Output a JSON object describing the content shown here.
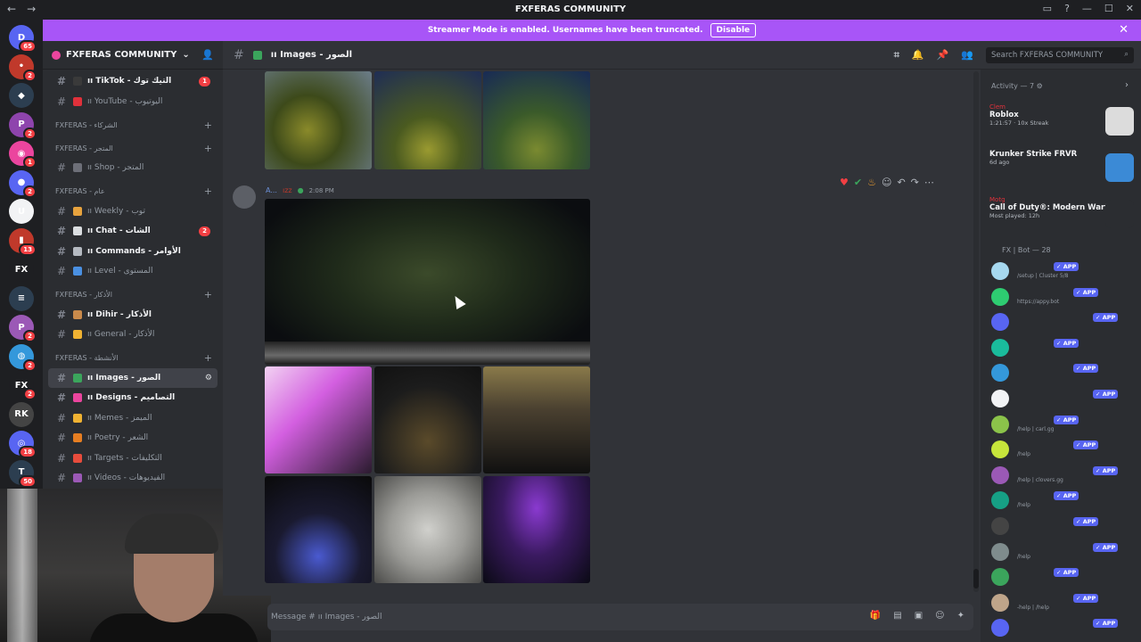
{
  "window": {
    "title": "FXFERAS COMMUNITY"
  },
  "banner": {
    "text": "Streamer Mode is enabled. Usernames have been truncated.",
    "disable_label": "Disable"
  },
  "server": {
    "name": "FXFERAS COMMUNITY"
  },
  "sidebar": {
    "items": [
      {
        "kind": "channel",
        "label": "ıı TikTok - التيك توك",
        "badge": "1",
        "bright": true,
        "emoji_color": "#3a3a3a"
      },
      {
        "kind": "channel",
        "label": "ıı YouTube - اليوتيوب",
        "badge": "",
        "bright": false,
        "emoji_color": "#e0313b"
      },
      {
        "kind": "category",
        "label": "FXFERAS - الشركاء"
      },
      {
        "kind": "category",
        "label": "FXFERAS - المتجر"
      },
      {
        "kind": "channel",
        "label": "ıı Shop - المتجر",
        "badge": "",
        "bright": false,
        "emoji_color": "#6d6f78"
      },
      {
        "kind": "category",
        "label": "FXFERAS - عام"
      },
      {
        "kind": "channel",
        "label": "ıı Weekly - توب",
        "badge": "",
        "bright": false,
        "emoji_color": "#e7a33e"
      },
      {
        "kind": "channel",
        "label": "ıı Chat - الشات",
        "badge": "2",
        "bright": true,
        "emoji_color": "#dbdee1"
      },
      {
        "kind": "channel",
        "label": "ıı Commands - الأوامر",
        "badge": "",
        "bright": true,
        "emoji_color": "#b5bac1"
      },
      {
        "kind": "channel",
        "label": "ıı Level - المستوى",
        "badge": "",
        "bright": false,
        "emoji_color": "#4a90e2"
      },
      {
        "kind": "category",
        "label": "FXFERAS - الأذكار"
      },
      {
        "kind": "channel",
        "label": "ıı Dihir - الأذكار",
        "badge": "",
        "bright": true,
        "emoji_color": "#c98a4b"
      },
      {
        "kind": "channel",
        "label": "ıı General - الأذكار",
        "badge": "",
        "bright": false,
        "emoji_color": "#f0b232"
      },
      {
        "kind": "category",
        "label": "FXFERAS - الأنشطة"
      },
      {
        "kind": "channel",
        "label": "ıı Images - الصور",
        "badge": "",
        "bright": true,
        "active": true,
        "emoji_color": "#3ba55c"
      },
      {
        "kind": "channel",
        "label": "ıı Designs - التصاميم",
        "badge": "",
        "bright": true,
        "emoji_color": "#eb459e"
      },
      {
        "kind": "channel",
        "label": "ıı Memes - الميمز",
        "badge": "",
        "bright": false,
        "emoji_color": "#f0b232"
      },
      {
        "kind": "channel",
        "label": "ıı Poetry - الشعر",
        "badge": "",
        "bright": false,
        "emoji_color": "#e67e22"
      },
      {
        "kind": "channel",
        "label": "ıı Targets - التكليفات",
        "badge": "",
        "bright": false,
        "emoji_color": "#e74c3c"
      },
      {
        "kind": "channel",
        "label": "ıı Videos - الفيديوهات",
        "badge": "",
        "bright": false,
        "emoji_color": "#9b59b6"
      }
    ]
  },
  "servers": [
    {
      "label": "D",
      "color": "#5865f2",
      "badge": "65"
    },
    {
      "label": "•",
      "color": "#c0392b",
      "badge": "2"
    },
    {
      "label": "◆",
      "color": "#2c3e50",
      "badge": ""
    },
    {
      "label": "P",
      "color": "#8e44ad",
      "badge": "2"
    },
    {
      "label": "◉",
      "color": "#eb459e",
      "badge": "1"
    },
    {
      "label": "●",
      "color": "#5865f2",
      "badge": "2"
    },
    {
      "label": "U",
      "color": "#f2f3f5",
      "badge": ""
    },
    {
      "label": "▮",
      "color": "#c0392b",
      "badge": "13"
    },
    {
      "label": "FX",
      "color": "#1e1f22",
      "badge": ""
    },
    {
      "label": "≡",
      "color": "#2c3e50",
      "badge": ""
    },
    {
      "label": "P",
      "color": "#9b59b6",
      "badge": "2"
    },
    {
      "label": "◍",
      "color": "#3498db",
      "badge": "2"
    },
    {
      "label": "FX",
      "color": "#1e1f22",
      "badge": "2"
    },
    {
      "label": "RK",
      "color": "#444",
      "badge": ""
    },
    {
      "label": "◎",
      "color": "#5865f2",
      "badge": "18"
    },
    {
      "label": "T",
      "color": "#2c3e50",
      "badge": "50"
    }
  ],
  "channel": {
    "title": "ıı Images - الصور"
  },
  "search": {
    "placeholder": "Search FXFERAS COMMUNITY"
  },
  "message": {
    "author": "A...",
    "tag": "ızz",
    "time": "2:08 PM"
  },
  "composer": {
    "placeholder": "Message # ıı Images - الصور"
  },
  "activity": {
    "header": "Activity — 7",
    "items": [
      {
        "user": "Clem",
        "game": "Roblox",
        "detail": "1:21:57 · 10x Streak",
        "thumb_color": "#dcdcdc"
      },
      {
        "user": "",
        "game": "Krunker Strike FRVR",
        "detail": "6d ago",
        "thumb_color": "#3b8ad6"
      },
      {
        "user": "Motg",
        "game": "Call of Duty®: Modern Warf...",
        "detail": "Most played: 12h",
        "thumb_color": "#2b2d31"
      }
    ]
  },
  "members": {
    "header": "FX | Bot — 28",
    "items": [
      {
        "status": "/setup | Cluster 5/8",
        "color": "#a6d8ef",
        "app": "✓ APP"
      },
      {
        "status": "https://appy.bot",
        "color": "#2ecc71",
        "app": "✓ APP"
      },
      {
        "status": "",
        "color": "#5865f2",
        "app": "✓ APP"
      },
      {
        "status": "",
        "color": "#1abc9c",
        "app": "✓ APP"
      },
      {
        "status": "",
        "color": "#3498db",
        "app": "✓ APP"
      },
      {
        "status": "",
        "color": "#f2f3f5",
        "app": "✓ APP"
      },
      {
        "status": "/help | carl.gg",
        "color": "#8bc34a",
        "app": "✓ APP"
      },
      {
        "status": "/help",
        "color": "#c7e53b",
        "app": "✓ APP"
      },
      {
        "status": "/help | clovers.gg",
        "color": "#9b59b6",
        "app": "✓ APP"
      },
      {
        "status": "/help",
        "color": "#16a085",
        "app": "✓ APP"
      },
      {
        "status": "",
        "color": "#444",
        "app": "✓ APP"
      },
      {
        "status": "/help",
        "color": "#7f8c8d",
        "app": "✓ APP"
      },
      {
        "status": "",
        "color": "#3ba55c",
        "app": "✓ APP"
      },
      {
        "status": "-help | /help",
        "color": "#bfa58a",
        "app": "✓ APP"
      },
      {
        "status": "",
        "color": "#5865f2",
        "app": "✓ APP"
      }
    ]
  },
  "colors": {
    "accent": "#a855f7",
    "blurple": "#5865f2",
    "danger": "#f23f43"
  }
}
